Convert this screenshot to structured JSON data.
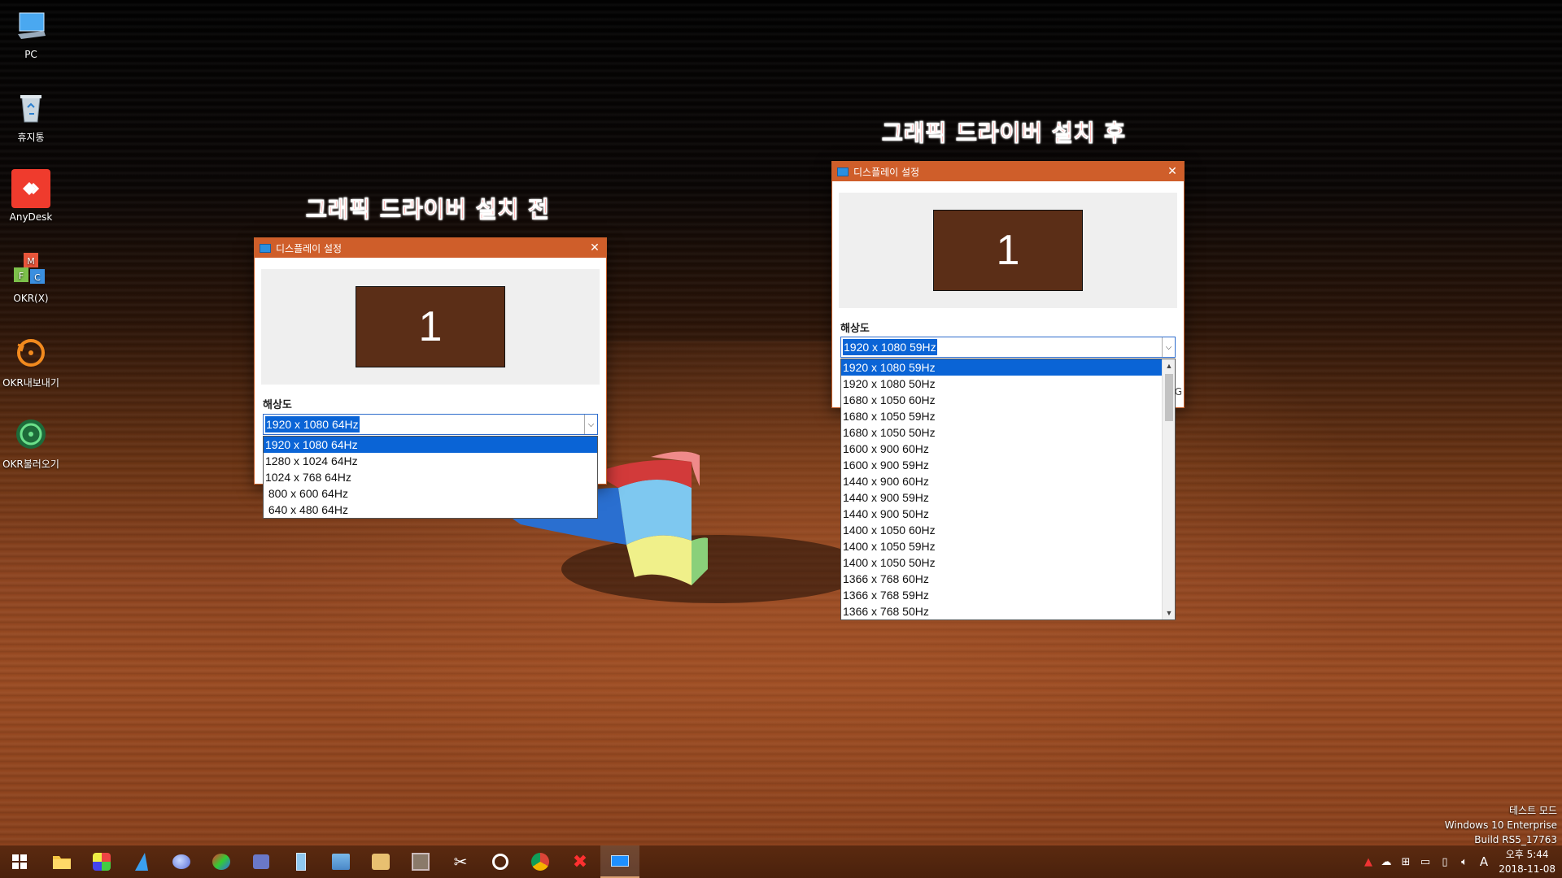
{
  "desktop_icons": [
    {
      "label": "PC",
      "icon": "computer-icon"
    },
    {
      "label": "휴지통",
      "icon": "recycle-bin-icon"
    },
    {
      "label": "AnyDesk",
      "icon": "anydesk-icon"
    },
    {
      "label": "OKR(X)",
      "icon": "okr-cubes-icon"
    },
    {
      "label": "OKR내보내기",
      "icon": "export-icon"
    },
    {
      "label": "OKR불러오기",
      "icon": "import-icon"
    }
  ],
  "annotations": {
    "before": "그래픽 드라이버 설치 전",
    "after": "그래픽 드라이버 설치 후"
  },
  "dialog_before": {
    "title": "디스플레이 설정",
    "monitor_label": "1",
    "resolution_label": "해상도",
    "selected": "1920 x 1080 64Hz",
    "options": [
      "1920 x 1080 64Hz",
      "1280 x 1024 64Hz",
      "1024 x 768 64Hz",
      " 800 x 600 64Hz",
      " 640 x 480 64Hz"
    ]
  },
  "dialog_after": {
    "title": "디스플레이 설정",
    "monitor_label": "1",
    "resolution_label": "해상도",
    "selected": "1920 x 1080 59Hz",
    "options": [
      "1920 x 1080 59Hz",
      "1920 x 1080 50Hz",
      "1680 x 1050 60Hz",
      "1680 x 1050 59Hz",
      "1680 x 1050 50Hz",
      "1600 x 900 60Hz",
      "1600 x 900 59Hz",
      "1440 x 900 60Hz",
      "1440 x 900 59Hz",
      "1440 x 900 50Hz",
      "1400 x 1050 60Hz",
      "1400 x 1050 59Hz",
      "1400 x 1050 50Hz",
      "1366 x 768 60Hz",
      "1366 x 768 59Hz",
      "1366 x 768 50Hz"
    ],
    "edge_glyph": "G"
  },
  "watermark": {
    "line1": "테스트 모드",
    "line2": "Windows 10 Enterprise",
    "line3": "Build   RS5_17763"
  },
  "taskbar": {
    "pinned": [
      "start-icon",
      "file-explorer-icon",
      "app-icon",
      "app-icon",
      "app-icon",
      "app-icon",
      "app-icon",
      "app-icon",
      "app-icon",
      "app-icon",
      "app-icon",
      "tools-icon",
      "app-icon",
      "chrome-icon",
      "close-app-icon",
      "display-settings-icon"
    ],
    "ime": "A",
    "time": "오후 5:44",
    "date": "2018-11-08"
  },
  "colors": {
    "titlebar": "#cf5e2a",
    "selection": "#0a64d6",
    "monitor": "#5b2e17",
    "annotation": "#ff1a1a"
  }
}
